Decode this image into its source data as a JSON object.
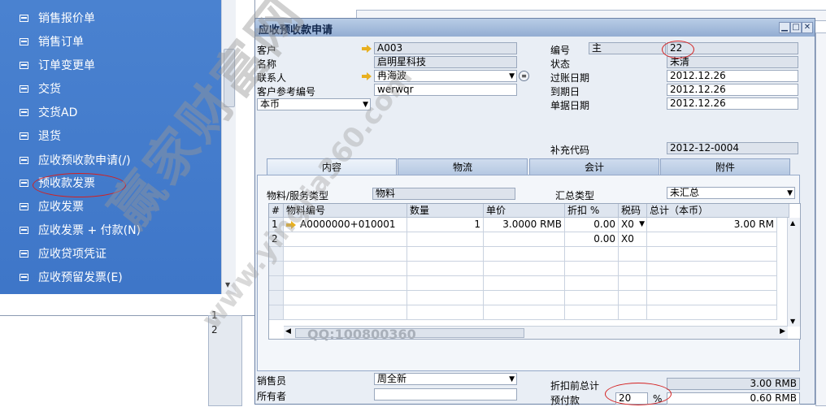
{
  "menu": {
    "items": [
      {
        "label": "销售报价单"
      },
      {
        "label": "销售订单"
      },
      {
        "label": "订单变更单"
      },
      {
        "label": "交货"
      },
      {
        "label": "交货AD"
      },
      {
        "label": "退货"
      },
      {
        "label": "应收预收款申请(/)"
      },
      {
        "label": "预收款发票"
      },
      {
        "label": "应收发票"
      },
      {
        "label": "应收发票 + 付款(N)"
      },
      {
        "label": "应收贷项凭证"
      },
      {
        "label": "应收预留发票(E)"
      }
    ]
  },
  "background": {
    "row_numbers": [
      "1",
      "2"
    ]
  },
  "window": {
    "title": "应收预收款申请",
    "buttons": {
      "minimize": "▁",
      "maximize": "□",
      "close": "✕"
    }
  },
  "header": {
    "customer_label": "客户",
    "customer_value": "A003",
    "name_label": "名称",
    "name_value": "启明星科技",
    "contact_label": "联系人",
    "contact_value": "冉海波",
    "cust_ref_label": "客户参考编号",
    "cust_ref_value": "werwqr",
    "currency_value": "本币",
    "number_label": "编号",
    "number_series": "主",
    "number_value": "22",
    "status_label": "状态",
    "status_value": "未清",
    "posting_date_label": "过账日期",
    "posting_date_value": "2012.12.26",
    "due_date_label": "到期日",
    "due_date_value": "2012.12.26",
    "doc_date_label": "单据日期",
    "doc_date_value": "2012.12.26",
    "supp_code_label": "补充代码",
    "supp_code_value": "2012-12-0004"
  },
  "tabs": [
    {
      "label": "内容"
    },
    {
      "label": "物流"
    },
    {
      "label": "会计"
    },
    {
      "label": "附件"
    }
  ],
  "content": {
    "item_type_label": "物料/服务类型",
    "item_type_value": "物料",
    "summary_type_label": "汇总类型",
    "summary_type_value": "未汇总"
  },
  "grid": {
    "columns": [
      "#",
      "物料编号",
      "数量",
      "单价",
      "折扣 %",
      "税码",
      "总计（本币）"
    ],
    "rows": [
      {
        "no": "1",
        "item": "A0000000+010001",
        "qty": "1",
        "price": "3.0000 RMB",
        "discount": "0.00",
        "tax": "X0",
        "total": "3.00 RM"
      },
      {
        "no": "2",
        "item": "",
        "qty": "",
        "price": "",
        "discount": "0.00",
        "tax": "X0",
        "total": ""
      }
    ]
  },
  "footer": {
    "sales_emp_label": "销售员",
    "sales_emp_value": "周全新",
    "owner_label": "所有者",
    "owner_value": "",
    "total_before_disc_label": "折扣前总计",
    "total_before_disc_value": "3.00 RMB",
    "down_payment_label": "预付款",
    "down_payment_percent": "20",
    "percent_sign": "%",
    "down_payment_value": "0.60 RMB"
  },
  "watermarks": {
    "qq": "QQ:100800360",
    "brand": "赢家财富网",
    "url": "www.yingjia360.com"
  },
  "colors": {
    "menu_bg": "#3e76c8",
    "highlight_ellipse": "#d42020",
    "link_arrow": "#e8b020"
  }
}
